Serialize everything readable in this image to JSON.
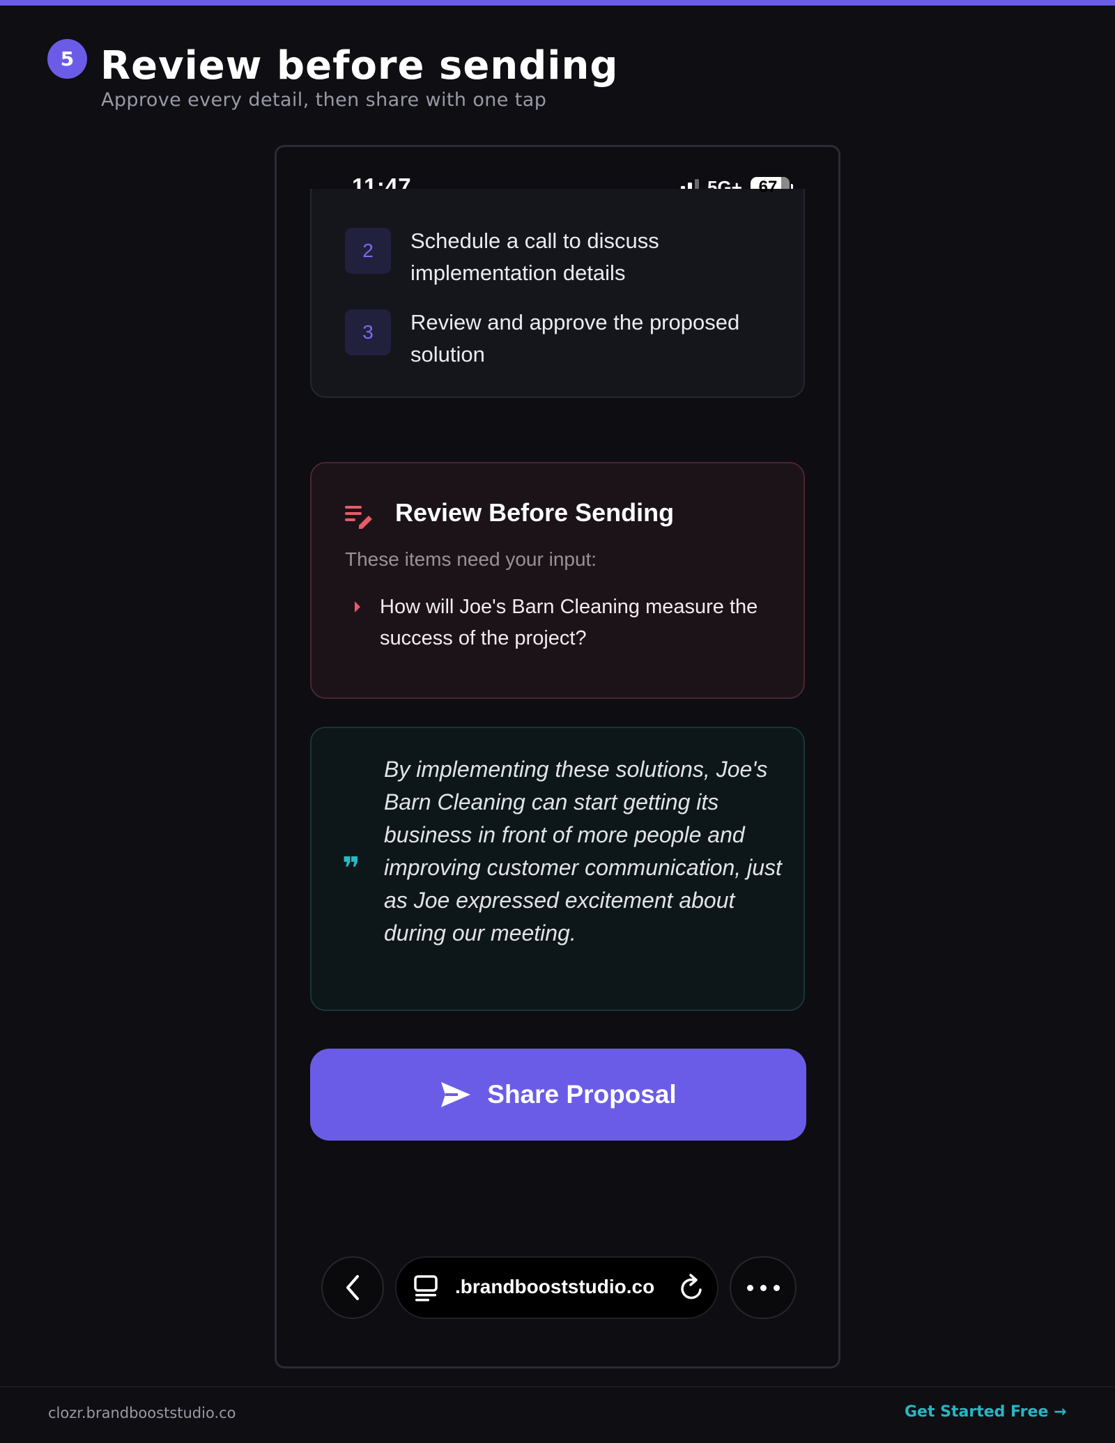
{
  "step": {
    "number": "5",
    "title": "Review before sending",
    "subtitle": "Approve every detail, then share with one tap"
  },
  "phone": {
    "status": {
      "time": "11:47",
      "network": "5G+",
      "battery": "67"
    },
    "next_steps": [
      {
        "number": "2",
        "text": "Schedule a call to discuss implementation details"
      },
      {
        "number": "3",
        "text": "Review and approve the proposed solution"
      }
    ],
    "review": {
      "title": "Review Before Sending",
      "subtitle": "These items need your input:",
      "items": [
        "How will Joe's Barn Cleaning measure the success of the project?"
      ]
    },
    "quote": {
      "text": "By implementing these solutions, Joe's Barn Cleaning can start getting its business in front of more people and improving customer communication, just as Joe expressed excitement about during our meeting."
    },
    "share_button": {
      "label": "Share Proposal"
    },
    "browser": {
      "url": ".brandbooststudio.co"
    }
  },
  "footer": {
    "domain": "clozr.brandbooststudio.co",
    "cta": "Get Started Free →"
  },
  "colors": {
    "accent": "#6b5ce7",
    "teal": "#26b7c3",
    "alert": "#e85a67"
  },
  "icons": {
    "review": "edit-list-icon",
    "quote": "quote-icon",
    "send": "send-icon",
    "back": "chevron-left-icon",
    "tabs": "tabs-icon",
    "reload": "reload-icon",
    "more": "more-icon"
  }
}
